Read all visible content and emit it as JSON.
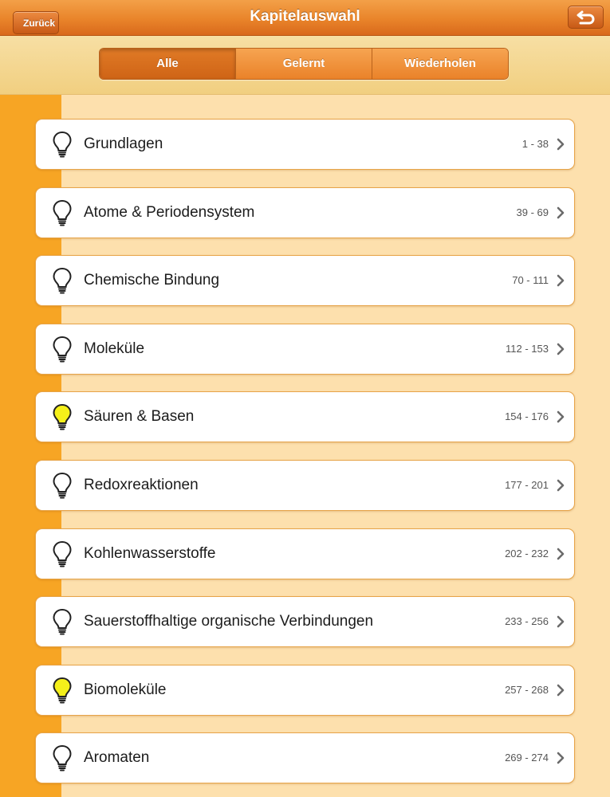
{
  "navbar": {
    "title": "Kapitelauswahl",
    "back_label": "Zurück",
    "return_icon": "return-arrow-icon"
  },
  "filter": {
    "segments": [
      "Alle",
      "Gelernt",
      "Wiederholen"
    ],
    "selected": "Alle"
  },
  "colors": {
    "accent": "#e9842a",
    "sidebar": "#f7a524",
    "content_background": "#fde0ad",
    "bulb_on": "#f5f01a",
    "bulb_off": "#ffffff"
  },
  "chapters": [
    {
      "title": "Grundlagen",
      "range": "1 - 38",
      "learned": false
    },
    {
      "title": "Atome & Periodensystem",
      "range": "39 - 69",
      "learned": false
    },
    {
      "title": "Chemische Bindung",
      "range": "70 - 111",
      "learned": false
    },
    {
      "title": "Moleküle",
      "range": "112 - 153",
      "learned": false
    },
    {
      "title": "Säuren & Basen",
      "range": "154 - 176",
      "learned": true
    },
    {
      "title": "Redoxreaktionen",
      "range": "177 - 201",
      "learned": false
    },
    {
      "title": "Kohlenwasserstoffe",
      "range": "202 - 232",
      "learned": false
    },
    {
      "title": "Sauerstoffhaltige organische Verbindungen",
      "range": "233 - 256",
      "learned": false
    },
    {
      "title": "Biomoleküle",
      "range": "257 - 268",
      "learned": true
    },
    {
      "title": "Aromaten",
      "range": "269 - 274",
      "learned": false
    }
  ]
}
